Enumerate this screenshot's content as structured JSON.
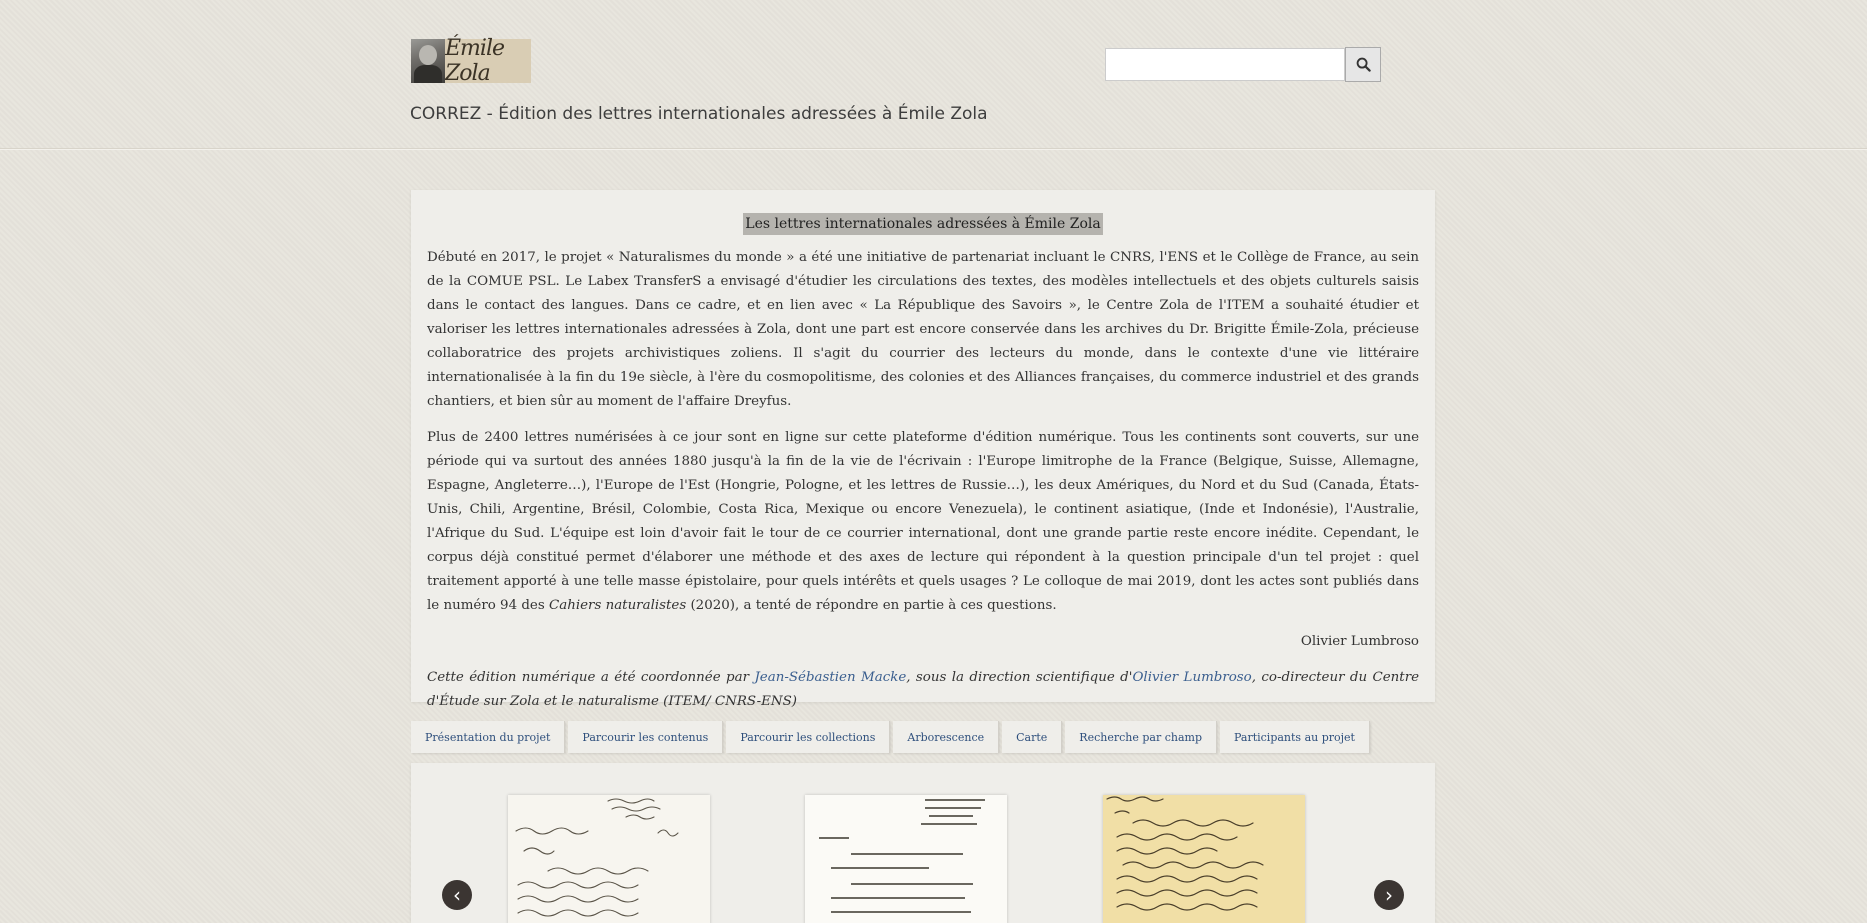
{
  "logo": {
    "signature_text": "Émile Zola",
    "portrait_icon": "portrait-icon"
  },
  "site_title": "CORREZ - Édition des lettres internationales adressées à Émile Zola",
  "search": {
    "placeholder": "",
    "button_icon": "search-icon"
  },
  "intro": {
    "heading": "Les lettres internationales adressées à Émile Zola",
    "p1": "Débuté en 2017, le projet « Naturalismes du monde » a été une initiative de partenariat incluant le CNRS, l'ENS et le Collège de France, au sein de la COMUE PSL. Le Labex TransferS a envisagé d'étudier les circulations des textes, des modèles intellectuels et des objets culturels saisis dans le contact des langues. Dans ce cadre, et en lien avec « La République des Savoirs », le Centre Zola de l'ITEM a souhaité étudier et valoriser les lettres internationales adressées à Zola, dont une part est encore conservée dans les archives du Dr. Brigitte Émile-Zola, précieuse collaboratrice des projets archivistiques zoliens. Il s'agit du courrier des lecteurs du monde, dans le contexte d'une vie littéraire internationalisée à la fin du 19e siècle, à l'ère du cosmopolitisme, des colonies et des Alliances françaises, du commerce industriel et des grands chantiers, et bien sûr au moment de l'affaire Dreyfus.",
    "p2_before": "Plus de 2400 lettres numérisées à ce jour sont en ligne sur cette plateforme d'édition numérique. Tous les continents sont couverts, sur une période qui va surtout des années 1880 jusqu'à la fin de la vie de l'écrivain : l'Europe limitrophe de la France (Belgique, Suisse, Allemagne, Espagne, Angleterre…), l'Europe de l'Est (Hongrie, Pologne, et les lettres de Russie…), les deux Amériques, du Nord et du Sud (Canada, États-Unis, Chili, Argentine, Brésil, Colombie, Costa Rica, Mexique ou encore Venezuela), le continent asiatique, (Inde et Indonésie), l'Australie, l'Afrique du Sud. L'équipe est loin d'avoir fait le tour de ce courrier international, dont une grande partie reste encore inédite. Cependant, le corpus déjà constitué permet d'élaborer une méthode et des axes de lecture qui répondent à la question principale d'un tel projet : quel traitement apporté à une telle masse épistolaire, pour quels intérêts et quels usages ? Le colloque de mai 2019, dont les actes sont publiés dans le numéro 94 des ",
    "p2_italic": "Cahiers naturalistes",
    "p2_after": " (2020), a tenté de répondre en partie à ces questions.",
    "signature": "Olivier Lumbroso",
    "credit_1": "Cette édition numérique a été coordonnée par ",
    "credit_link1": "Jean-Sébastien Macke",
    "credit_2": ", sous la direction scientifique d'",
    "credit_link2": "Olivier Lumbroso",
    "credit_3": ", co-directeur du Centre d'Étude sur Zola et le naturalisme (ITEM/ CNRS-ENS)"
  },
  "tabs": [
    "Présentation du projet",
    "Parcourir les contenus",
    "Parcourir les collections",
    "Arborescence",
    "Carte",
    "Recherche par champ",
    "Participants au projet"
  ],
  "gallery": {
    "prev": "‹",
    "next": "›",
    "thumbs": [
      {
        "icon": "handwritten-letter-icon",
        "paper": "#f7f5ef"
      },
      {
        "icon": "typed-letter-icon",
        "paper": "#fbfaf6"
      },
      {
        "icon": "handwritten-letter-icon",
        "paper": "#f1dfa6"
      }
    ]
  }
}
